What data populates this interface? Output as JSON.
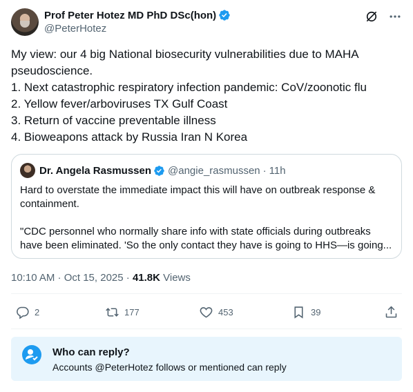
{
  "author": {
    "name": "Prof Peter Hotez MD PhD DSc(hon)",
    "handle": "@PeterHotez"
  },
  "tweet": {
    "lines": [
      "My view: our 4 big National biosecurity vulnerabilities due to MAHA",
      "pseudoscience.",
      "1. Next catastrophic respiratory infection pandemic: CoV/zoonotic flu",
      "2. Yellow fever/arboviruses TX Gulf Coast",
      "3. Return of vaccine preventable illness",
      "4. Bioweapons attack by Russia Iran N Korea"
    ],
    "time": "10:10 AM · Oct 15, 2025 ·",
    "views_count": "41.8K",
    "views_label": "Views"
  },
  "quote": {
    "name": "Dr. Angela Rasmussen",
    "handle": "@angie_rasmussen",
    "dot": "·",
    "time": "11h",
    "line1": "Hard to overstate the immediate impact this will have on outbreak response &",
    "line2": "containment.",
    "line3": "\"CDC personnel who normally share info with state officials during outbreaks",
    "line4": "have been eliminated. 'So the only contact they have is going  to HHS—is going..."
  },
  "actions": {
    "replies": "2",
    "reposts": "177",
    "likes": "453",
    "bookmarks": "39"
  },
  "reply_restriction": {
    "title": "Who can reply?",
    "subtitle": "Accounts @PeterHotez follows or mentioned can reply"
  },
  "colors": {
    "accent": "#1d9bf0",
    "secondary_text": "#536471",
    "reply_box_bg": "#e8f5fd"
  }
}
